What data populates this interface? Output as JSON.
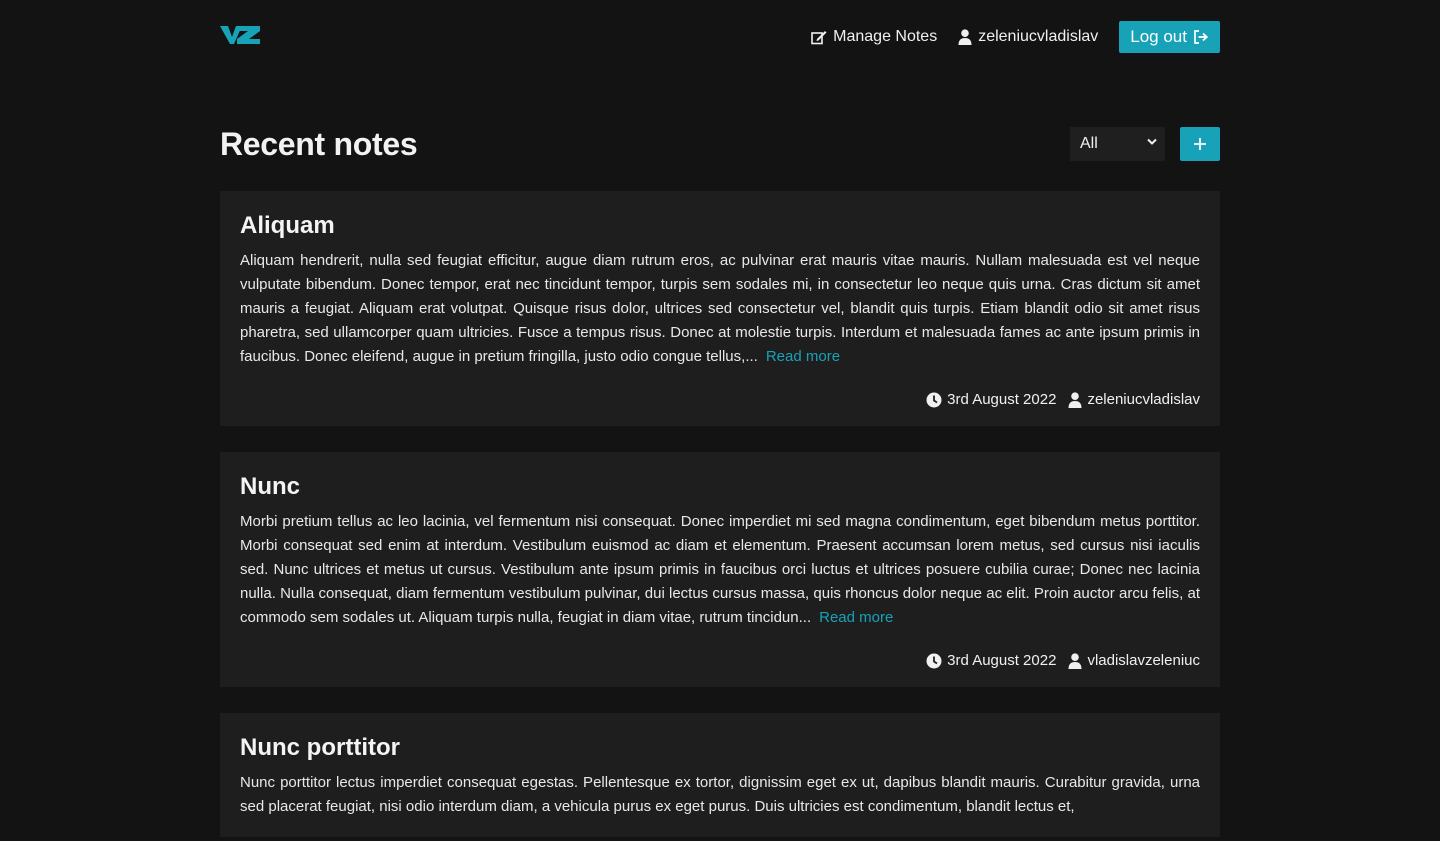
{
  "header": {
    "logo_text": "VZ",
    "manage_notes_label": "Manage Notes",
    "username": "zeleniucvladislav",
    "logout_label": "Log out"
  },
  "main": {
    "title": "Recent notes",
    "filter_selected": "All"
  },
  "colors": {
    "accent": "#17a2b8",
    "background": "#131313",
    "card": "#1e1e1e"
  },
  "notes": [
    {
      "title": "Aliquam",
      "body": "Aliquam hendrerit, nulla sed feugiat efficitur, augue diam rutrum eros, ac pulvinar erat mauris vitae mauris. Nullam malesuada est vel neque vulputate bibendum. Donec tempor, erat nec tincidunt tempor, turpis sem sodales mi, in consectetur leo neque quis urna. Cras dictum sit amet mauris a feugiat. Aliquam erat volutpat. Quisque risus dolor, ultrices sed consectetur vel, blandit quis turpis. Etiam blandit odio sit amet risus pharetra, sed ullamcorper quam ultricies. Fusce a tempus risus. Donec at molestie turpis. Interdum et malesuada fames ac ante ipsum primis in faucibus. Donec eleifend, augue in pretium fringilla, justo odio congue tellus,...",
      "read_more": "Read more",
      "date": "3rd August 2022",
      "author": "zeleniucvladislav"
    },
    {
      "title": "Nunc",
      "body": "Morbi pretium tellus ac leo lacinia, vel fermentum nisi consequat. Donec imperdiet mi sed magna condimentum, eget bibendum metus porttitor. Morbi consequat sed enim at interdum. Vestibulum euismod ac diam et elementum. Praesent accumsan lorem metus, sed cursus nisi iaculis sed. Nunc ultrices et metus ut cursus. Vestibulum ante ipsum primis in faucibus orci luctus et ultrices posuere cubilia curae; Donec nec lacinia nulla. Nulla consequat, diam fermentum vestibulum pulvinar, dui lectus cursus massa, quis rhoncus dolor neque ac elit. Proin auctor arcu felis, at commodo sem sodales ut. Aliquam turpis nulla, feugiat in diam vitae, rutrum tincidun...",
      "read_more": "Read more",
      "date": "3rd August 2022",
      "author": "vladislavzeleniuc"
    },
    {
      "title": "Nunc porttitor",
      "body": "Nunc porttitor lectus imperdiet consequat egestas. Pellentesque ex tortor, dignissim eget ex ut, dapibus blandit mauris. Curabitur gravida, urna sed placerat feugiat, nisi odio interdum diam, a vehicula purus ex eget purus. Duis ultricies est condimentum, blandit lectus et,"
    }
  ]
}
